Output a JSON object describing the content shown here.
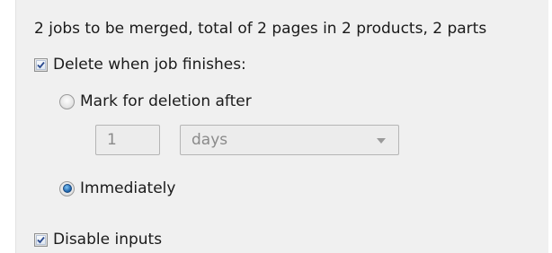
{
  "summary": "2 jobs to be merged, total of 2 pages in 2 products, 2 parts",
  "delete_when_finished": {
    "label": "Delete when job finishes:",
    "checked": true
  },
  "mark_for_deletion": {
    "label": "Mark for deletion after",
    "selected": false
  },
  "delay": {
    "value": "1",
    "unit": "days"
  },
  "immediately": {
    "label": "Immediately",
    "selected": true
  },
  "disable_inputs": {
    "label": "Disable inputs",
    "checked": true
  }
}
